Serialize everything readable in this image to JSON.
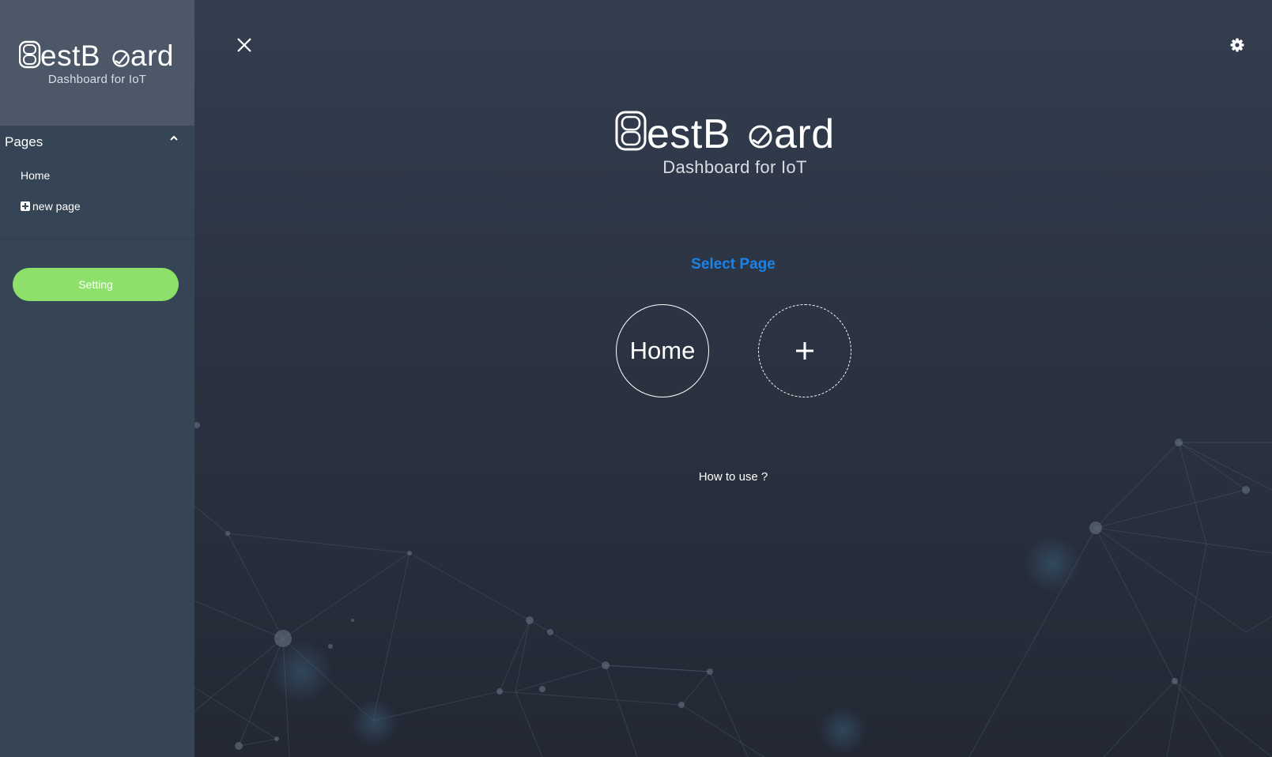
{
  "brand": {
    "name": "BestBoard",
    "logo_text": "estB",
    "logo_text_tail": "ard",
    "subtitle": "Dashboard for IoT"
  },
  "sidebar": {
    "section_title": "Pages",
    "items": [
      {
        "label": "Home",
        "icon": null
      },
      {
        "label": "new page",
        "icon": "plus-square-icon"
      }
    ],
    "setting_button": "Setting"
  },
  "main": {
    "select_page_label": "Select Page",
    "pages": [
      {
        "label": "Home"
      }
    ],
    "add_page_symbol": "+",
    "help_link": "How to use ?"
  },
  "colors": {
    "sidebar_bg": "#354555",
    "brand_panel_bg": "#4c5868",
    "main_bg_top": "#343e4f",
    "main_bg_bottom": "#232834",
    "accent_blue": "#1a82e8",
    "setting_green": "#8de06a"
  }
}
